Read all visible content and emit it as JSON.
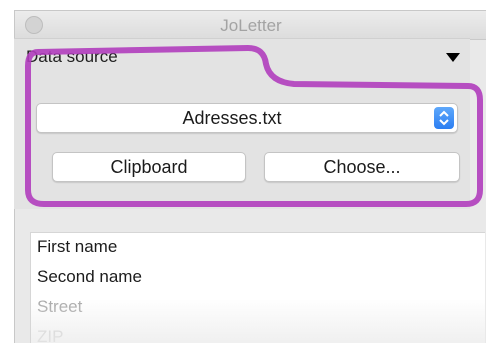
{
  "window": {
    "title": "JoLetter"
  },
  "data_source": {
    "header": "Data source",
    "selected_file": "Adresses.txt",
    "buttons": {
      "clipboard": "Clipboard",
      "choose": "Choose..."
    }
  },
  "fields": {
    "items": [
      {
        "label": "First name"
      },
      {
        "label": "Second name"
      },
      {
        "label": "Street"
      },
      {
        "label": "ZIP"
      }
    ]
  },
  "icons": {
    "collapse": "triangle-down-icon",
    "popup": "updown-arrows-icon",
    "window_control": "close-button-icon"
  },
  "colors": {
    "highlight": "#b03dbd",
    "accent": "#2b7ef2"
  }
}
